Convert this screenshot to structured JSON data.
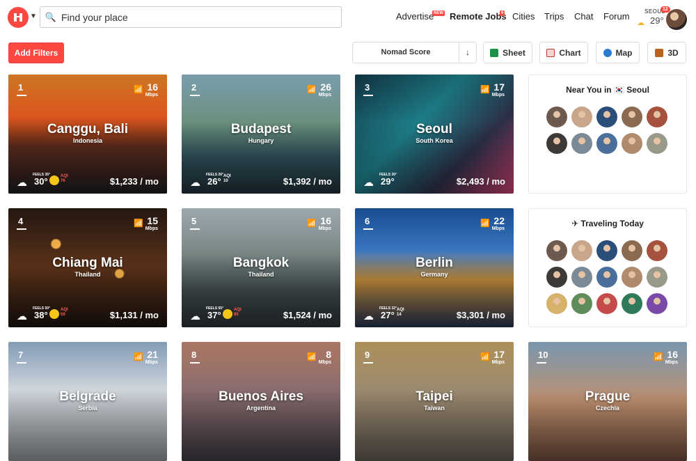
{
  "header": {
    "search_placeholder": "Find your place",
    "nav": {
      "advertise": "Advertise",
      "advertise_badge": "NEW",
      "remote_jobs": "Remote Jobs",
      "remote_jobs_badge": "6",
      "cities": "Cities",
      "trips": "Trips",
      "chat": "Chat",
      "forum": "Forum"
    },
    "weather": {
      "city": "SEOUL",
      "temp": "29°",
      "icon": "partly-cloudy-icon"
    },
    "notifications": "12"
  },
  "toolbar": {
    "add_filters": "Add Filters",
    "sort_label": "Nomad Score",
    "sort_dir": "↓",
    "views": [
      {
        "label": "Sheet",
        "icon": "sheet-icon",
        "color": "#1f8f4a"
      },
      {
        "label": "Chart",
        "icon": "chart-icon",
        "color": "#c0392b"
      },
      {
        "label": "Map",
        "icon": "globe-icon",
        "color": "#2a7bd1"
      },
      {
        "label": "3D",
        "icon": "cube-icon",
        "color": "#b5651d"
      }
    ]
  },
  "cities": [
    {
      "rank": "1",
      "city": "Canggu, Bali",
      "country": "Indonesia",
      "wifi": "16",
      "wifi_unit": "Mbps",
      "feels": "FEELS 35°",
      "temp": "30°",
      "aqi_label": "AQI",
      "aqi": "76",
      "aqi_warn": true,
      "cost": "$1,233 / mo"
    },
    {
      "rank": "2",
      "city": "Budapest",
      "country": "Hungary",
      "wifi": "26",
      "wifi_unit": "Mbps",
      "feels": "FEELS 26°",
      "temp": "26°",
      "aqi_label": "AQI",
      "aqi": "10",
      "aqi_warn": false,
      "cost": "$1,392 / mo"
    },
    {
      "rank": "3",
      "city": "Seoul",
      "country": "South Korea",
      "wifi": "17",
      "wifi_unit": "Mbps",
      "feels": "FEELS 30°",
      "temp": "29°",
      "aqi_label": "",
      "aqi": "",
      "aqi_warn": false,
      "cost": "$2,493 / mo"
    },
    {
      "rank": "4",
      "city": "Chiang Mai",
      "country": "Thailand",
      "wifi": "15",
      "wifi_unit": "Mbps",
      "feels": "FEELS 50°",
      "temp": "38°",
      "aqi_label": "AQI",
      "aqi": "59",
      "aqi_warn": true,
      "cost": "$1,131 / mo"
    },
    {
      "rank": "5",
      "city": "Bangkok",
      "country": "Thailand",
      "wifi": "16",
      "wifi_unit": "Mbps",
      "feels": "FEELS 55°",
      "temp": "37°",
      "aqi_label": "AQI",
      "aqi": "85",
      "aqi_warn": true,
      "cost": "$1,524 / mo"
    },
    {
      "rank": "6",
      "city": "Berlin",
      "country": "Germany",
      "wifi": "22",
      "wifi_unit": "Mbps",
      "feels": "FEELS 32°",
      "temp": "27°",
      "aqi_label": "AQI",
      "aqi": "14",
      "aqi_warn": false,
      "cost": "$3,301 / mo"
    },
    {
      "rank": "7",
      "city": "Belgrade",
      "country": "Serbia",
      "wifi": "21",
      "wifi_unit": "Mbps",
      "feels": "",
      "temp": "",
      "aqi_label": "",
      "aqi": "",
      "aqi_warn": false,
      "cost": ""
    },
    {
      "rank": "8",
      "city": "Buenos Aires",
      "country": "Argentina",
      "wifi": "8",
      "wifi_unit": "Mbps",
      "feels": "",
      "temp": "",
      "aqi_label": "",
      "aqi": "",
      "aqi_warn": false,
      "cost": ""
    },
    {
      "rank": "9",
      "city": "Taipei",
      "country": "Taiwan",
      "wifi": "17",
      "wifi_unit": "Mbps",
      "feels": "",
      "temp": "",
      "aqi_label": "",
      "aqi": "",
      "aqi_warn": false,
      "cost": ""
    },
    {
      "rank": "10",
      "city": "Prague",
      "country": "Czechia",
      "wifi": "16",
      "wifi_unit": "Mbps",
      "feels": "",
      "temp": "",
      "aqi_label": "",
      "aqi": "",
      "aqi_warn": false,
      "cost": ""
    }
  ],
  "near_you": {
    "title": "Near You in 🇰🇷 Seoul",
    "count": 10
  },
  "traveling": {
    "title": "✈ Traveling Today",
    "count": 15
  }
}
